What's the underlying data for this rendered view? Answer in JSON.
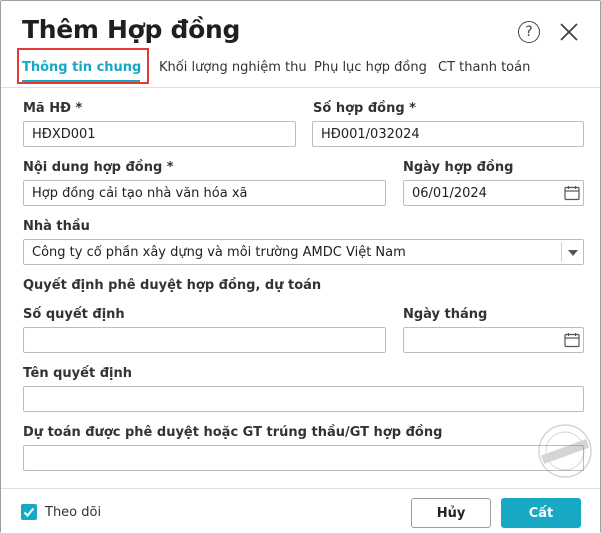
{
  "dialog": {
    "title": "Thêm Hợp đồng"
  },
  "tabs": [
    {
      "label": "Thông tin chung",
      "active": true
    },
    {
      "label": "Khối lượng nghiệm thu",
      "active": false
    },
    {
      "label": "Phụ lục hợp đồng",
      "active": false
    },
    {
      "label": "CT thanh toán",
      "active": false
    }
  ],
  "form": {
    "ma_hd": {
      "label": "Mã HĐ *",
      "value": "HĐXD001"
    },
    "so_hop_dong": {
      "label": "Số hợp đồng *",
      "value": "HĐ001/032024"
    },
    "noi_dung": {
      "label": "Nội dung hợp đồng *",
      "value": "Hợp đồng cải tạo nhà văn hóa xã"
    },
    "ngay_hop_dong": {
      "label": "Ngày hợp đồng",
      "value": "06/01/2024"
    },
    "nha_thau": {
      "label": "Nhà thầu",
      "value": "Công ty cổ phần xây dựng và môi trường AMDC Việt Nam"
    },
    "section_title": "Quyết định phê duyệt hợp đồng, dự toán",
    "so_quyet_dinh": {
      "label": "Số quyết định",
      "value": ""
    },
    "ngay_thang": {
      "label": "Ngày tháng",
      "value": ""
    },
    "ten_quyet_dinh": {
      "label": "Tên quyết định",
      "value": ""
    },
    "du_toan": {
      "label": "Dự toán được phê duyệt hoặc GT trúng thầu/GT hợp đồng",
      "value": ""
    }
  },
  "footer": {
    "follow_label": "Theo dõi",
    "follow_checked": true,
    "cancel_label": "Hủy",
    "save_label": "Cất"
  },
  "colors": {
    "accent": "#17a8c4",
    "highlight": "#e53935"
  },
  "icons": [
    "help-icon",
    "close-icon",
    "calendar-icon",
    "chevron-down-icon",
    "check-icon"
  ]
}
